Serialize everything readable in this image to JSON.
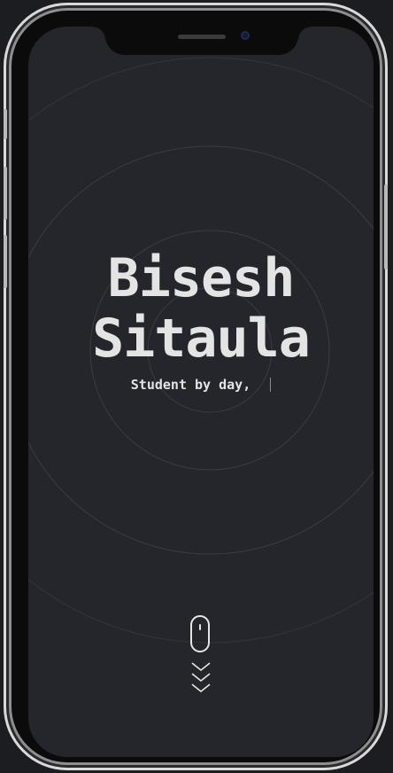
{
  "hero": {
    "first_name": "Bisesh",
    "last_name": "Sitaula",
    "tagline": "Student by day,"
  },
  "icons": {
    "scroll": "mouse-icon",
    "chevrons": "chevrons-down-icon",
    "speaker": "speaker-grille",
    "camera": "front-camera"
  },
  "colors": {
    "background": "#24262c",
    "text": "#e4e4e4",
    "rings": "#3a3c42",
    "frame": "#0b0b0c"
  }
}
